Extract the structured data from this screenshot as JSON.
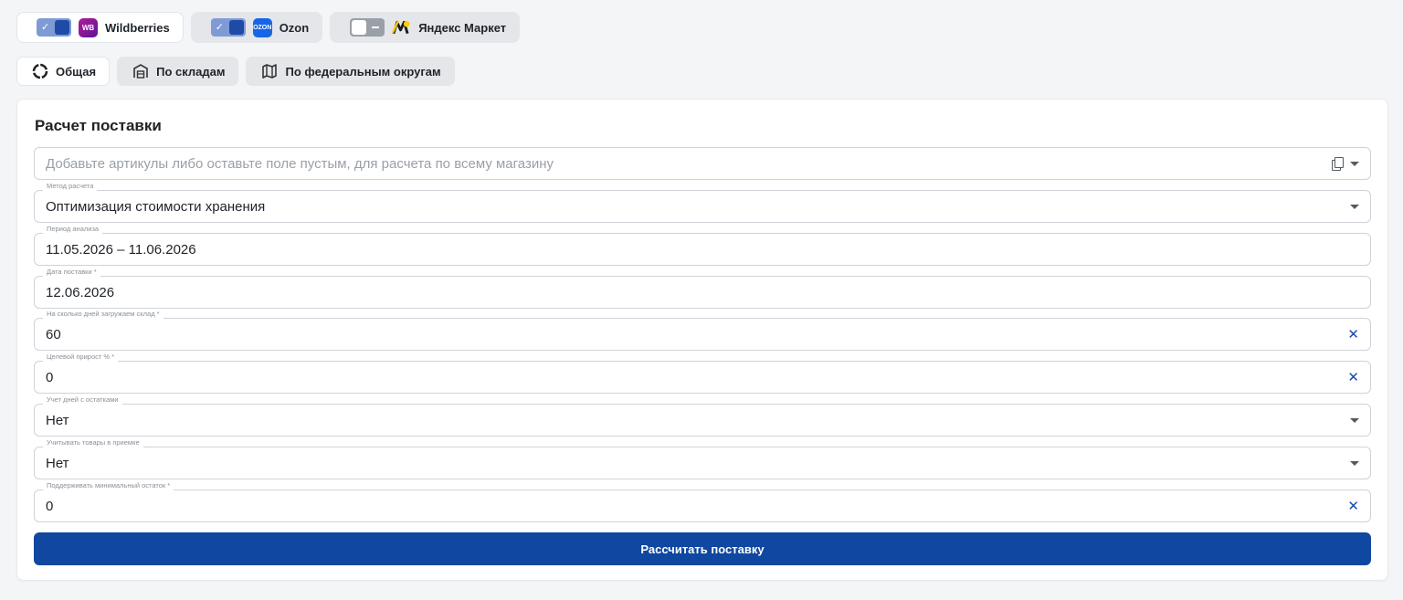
{
  "marketplaces": [
    {
      "name": "Wildberries",
      "logo": "WB",
      "enabled": true
    },
    {
      "name": "Ozon",
      "logo": "OZON",
      "enabled": true
    },
    {
      "name": "Яндекс Маркет",
      "logo": "",
      "enabled": false
    }
  ],
  "views": [
    {
      "label": "Общая",
      "icon": "circle-loading-icon",
      "active": true
    },
    {
      "label": "По складам",
      "icon": "warehouse-icon",
      "active": false
    },
    {
      "label": "По федеральным округам",
      "icon": "map-icon",
      "active": false
    }
  ],
  "form": {
    "title": "Расчет поставки",
    "articles": {
      "placeholder": "Добавьте артикулы либо оставьте поле пустым, для расчета по всему магазину"
    },
    "method": {
      "label": "Метод расчета",
      "value": "Оптимизация стоимости хранения"
    },
    "period": {
      "label": "Период анализа",
      "value": "11.05.2026 – 11.06.2026"
    },
    "delivery_date": {
      "label": "Дата поставки *",
      "value": "12.06.2026"
    },
    "days_load": {
      "label": "На сколько дней загружаем склад *",
      "value": "60"
    },
    "target_growth": {
      "label": "Целевой прирост % *",
      "value": "0"
    },
    "stock_days": {
      "label": "Учет дней с остатками",
      "value": "Нет"
    },
    "acceptance": {
      "label": "Учитывать товары в приемке",
      "value": "Нет"
    },
    "min_stock": {
      "label": "Поддерживать минимальный остаток *",
      "value": "0"
    },
    "submit_label": "Рассчитать поставку"
  },
  "colors": {
    "primary": "#0f47a1",
    "accent": "#1d4ba6"
  }
}
